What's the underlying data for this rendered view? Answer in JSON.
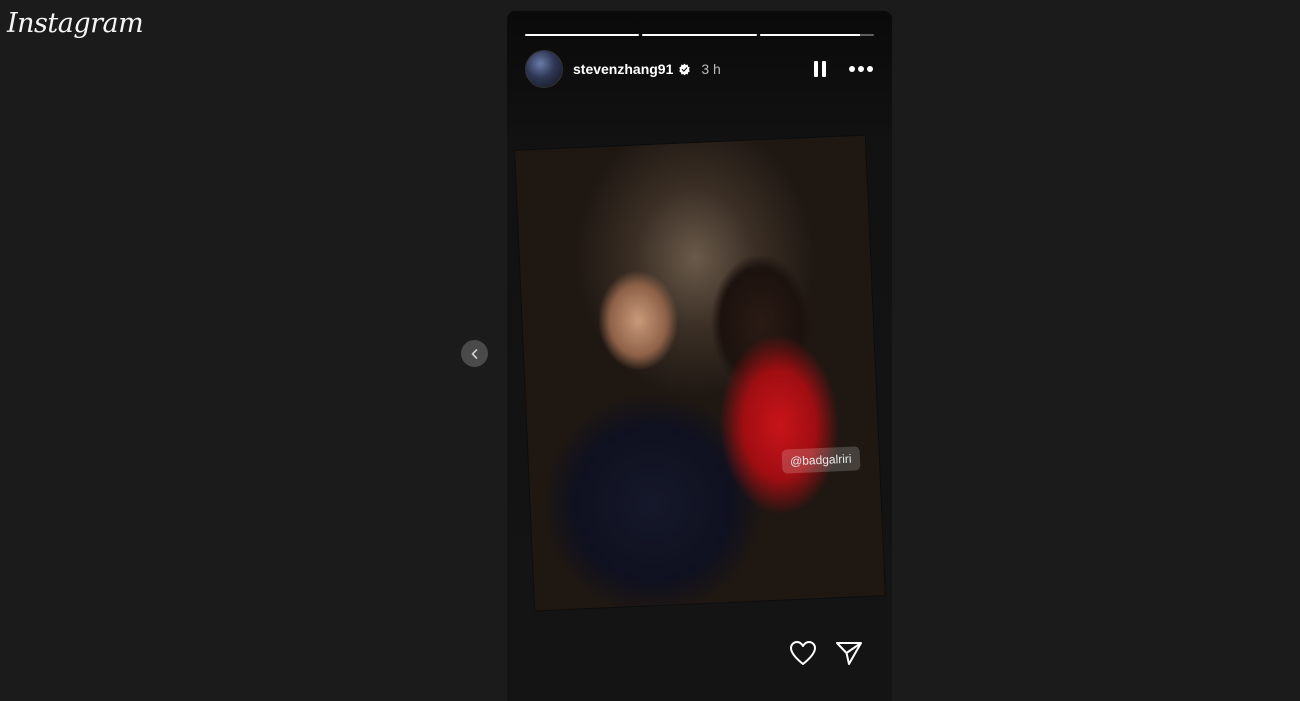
{
  "app": {
    "logo_text": "Instagram"
  },
  "story": {
    "progress": [
      1.0,
      1.0,
      0.88
    ],
    "username": "stevenzhang91",
    "verified": true,
    "time": "3 h",
    "mention_tag": "@badgalriri"
  },
  "icons": {
    "prev": "chevron-left-icon",
    "verified": "verified-badge-icon",
    "pause": "pause-icon",
    "more": "more-options-icon",
    "like": "heart-icon",
    "share": "send-icon"
  },
  "colors": {
    "page_bg": "#1b1b1b",
    "dress_red": "#c8141a",
    "verified_blue": "#ffffff"
  }
}
